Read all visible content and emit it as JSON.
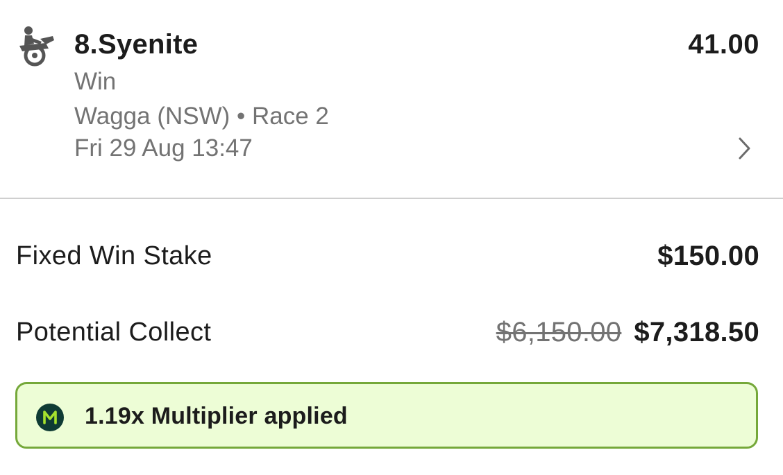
{
  "selection": {
    "runner": "8.Syenite",
    "odds": "41.00",
    "bet_type": "Win",
    "venue_race": "Wagga (NSW) • Race 2",
    "start_time": "Fri 29 Aug 13:47",
    "sport_icon": "horse-racing-icon",
    "chevron_icon": "chevron-right-icon"
  },
  "stake": {
    "label": "Fixed Win Stake",
    "value": "$150.00"
  },
  "collect": {
    "label": "Potential Collect",
    "original_value": "$6,150.00",
    "boosted_value": "$7,318.50"
  },
  "multiplier": {
    "icon_letter": "M",
    "text": "1.19x Multiplier applied",
    "icon_bg": "#0f3b34",
    "icon_fg": "#a6e22e",
    "banner_bg": "#edfdd6",
    "banner_border": "#75a83a"
  }
}
